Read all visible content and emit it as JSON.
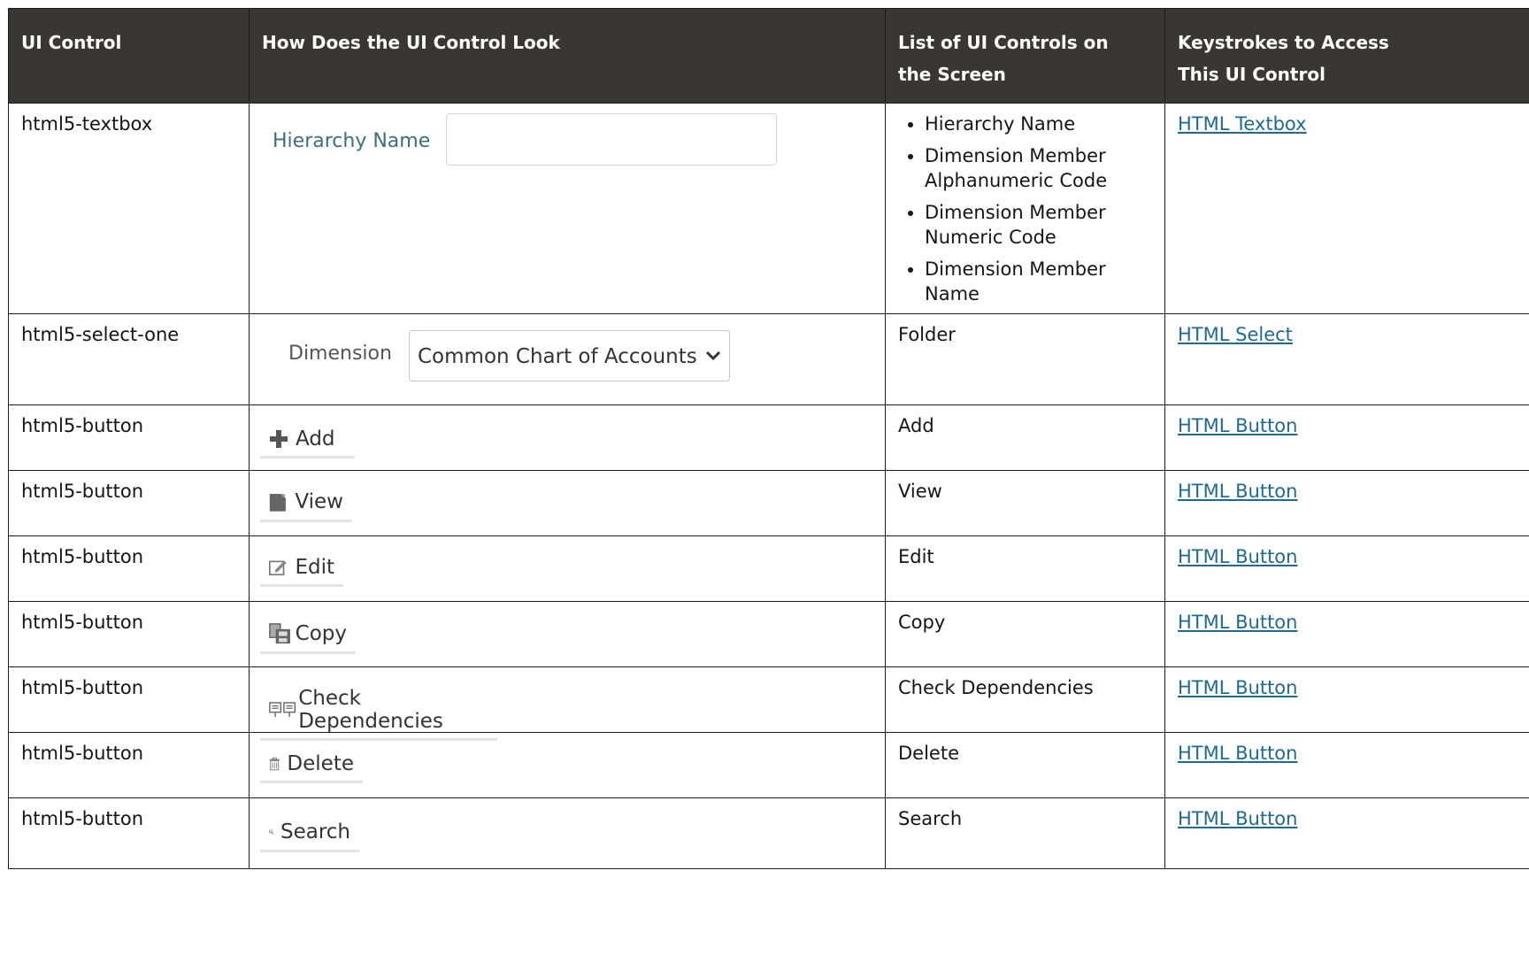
{
  "headers": [
    "UI Control",
    "How Does the UI Control Look",
    "List of UI Controls on the Screen",
    "Keystrokes to Access This UI Control"
  ],
  "rows": [
    {
      "control": "html5-textbox",
      "look_label": "Hierarchy Name",
      "list": [
        "Hierarchy Name",
        "Dimension Member Alphanumeric Code",
        "Dimension Member Numeric Code",
        "Dimension Member Name"
      ],
      "link": "HTML Textbox"
    },
    {
      "control": "html5-select-one",
      "look_label": "Dimension",
      "look_value": "Common Chart of Accounts",
      "list_text": "Folder",
      "link": "HTML Select"
    },
    {
      "control": "html5-button",
      "look_label": "Add",
      "icon": "plus-icon",
      "list_text": "Add",
      "link": "HTML Button"
    },
    {
      "control": "html5-button",
      "look_label": "View",
      "icon": "view-icon",
      "list_text": "View",
      "link": "HTML Button"
    },
    {
      "control": "html5-button",
      "look_label": "Edit",
      "icon": "edit-icon",
      "list_text": "Edit",
      "link": "HTML Button"
    },
    {
      "control": "html5-button",
      "look_label": "Copy",
      "icon": "copy-icon",
      "list_text": "Copy",
      "link": "HTML Button"
    },
    {
      "control": "html5-button",
      "look_label": "Check Dependencies",
      "icon": "dependencies-icon",
      "list_text": "Check Dependencies",
      "link": "HTML Button"
    },
    {
      "control": "html5-button",
      "look_label": "Delete",
      "icon": "trash-icon",
      "list_text": "Delete",
      "link": "HTML Button"
    },
    {
      "control": "html5-button",
      "look_label": "Search",
      "icon": "search-icon",
      "list_text": "Search",
      "link": "HTML Button"
    }
  ],
  "colors": {
    "header_bg": "#3a3631",
    "header_text": "#ffffff",
    "link": "#1d6a94",
    "border": "#1a1a1a"
  }
}
